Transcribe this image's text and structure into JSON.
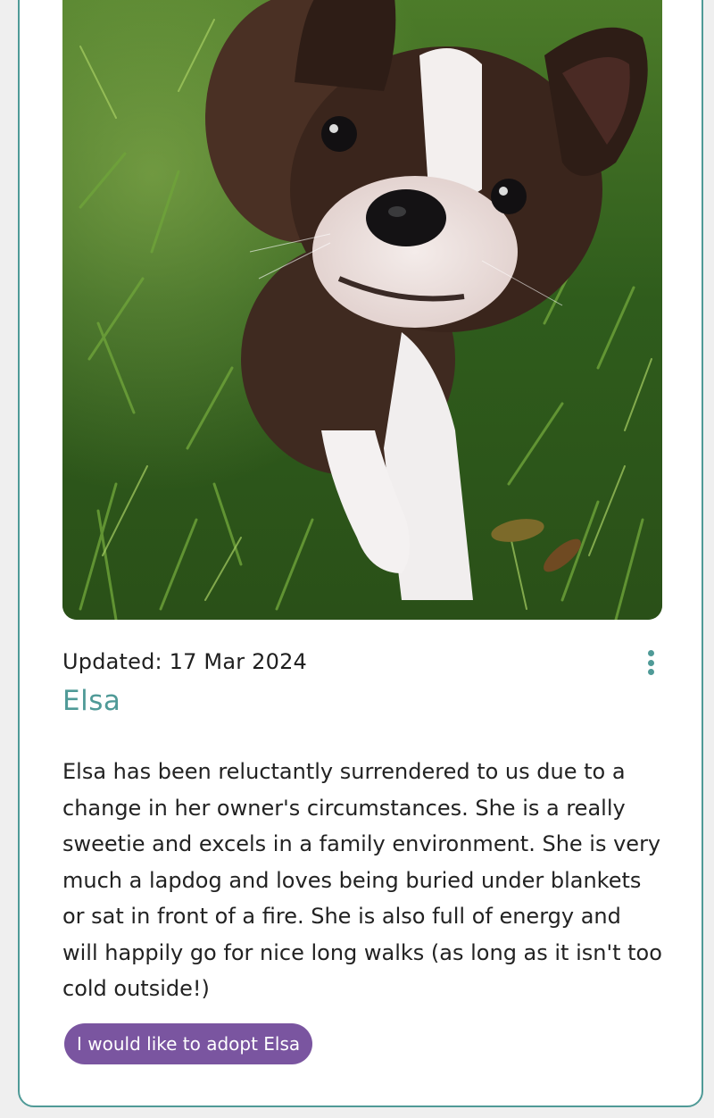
{
  "theme": {
    "accent": "#4f9a97",
    "button_color": "#7a55a0",
    "card_border": "#4f9a97"
  },
  "pet": {
    "photo_icon": "dog-photo",
    "updated_text": "Updated: 17 Mar 2024",
    "name": "Elsa",
    "description": "Elsa has been reluctantly surrendered to us due to a change in her owner's circumstances. She is a really sweetie and excels in a family environment. She is very much a lapdog and loves being buried under blankets or sat in front of a fire. She is also full of energy and will happily go for nice long walks (as long as it isn't too cold outside!)",
    "adopt_label": "I would like to adopt Elsa",
    "menu_icon": "more-vertical-icon"
  }
}
